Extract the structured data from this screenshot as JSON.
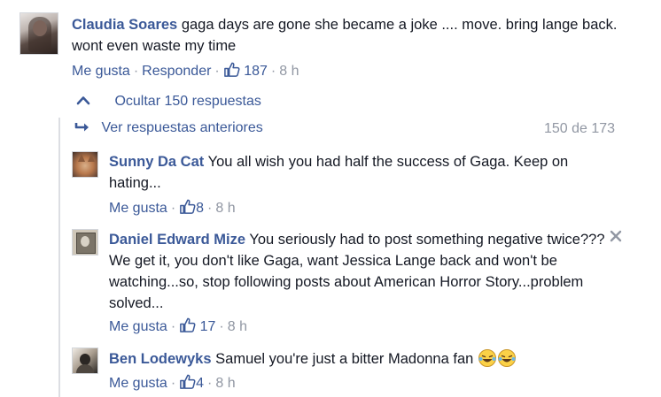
{
  "comment": {
    "author": "Claudia Soares",
    "text": "gaga days are gone she became a joke .... move. bring lange back. wont even waste my time",
    "like_label": "Me gusta",
    "reply_label": "Responder",
    "likes": "187",
    "time": "8 h"
  },
  "replies_controls": {
    "hide_label": "Ocultar 150 respuestas",
    "previous_label": "Ver respuestas anteriores",
    "count": "150 de 173"
  },
  "replies": [
    {
      "author": "Sunny Da Cat",
      "text": "You all wish you had half the success of Gaga. Keep on hating...",
      "like_label": "Me gusta",
      "likes": "8",
      "time": "8 h"
    },
    {
      "author": "Daniel Edward Mize",
      "text": "You seriously had to post something negative twice??? We get it, you don't like Gaga, want Jessica Lange back and won't be watching...so, stop following posts about American Horror Story...problem solved...",
      "like_label": "Me gusta",
      "likes": "17",
      "time": "8 h"
    },
    {
      "author": "Ben Lodewyks",
      "text": "Samuel you're just a bitter Madonna fan",
      "like_label": "Me gusta",
      "likes": "4",
      "time": "8 h"
    }
  ],
  "colors": {
    "link": "#3b5998",
    "grey": "#9197a3",
    "text": "#141823"
  },
  "icons": [
    "thumbs-up-icon",
    "chevron-up-icon",
    "reply-arrow-icon",
    "close-icon",
    "laughing-tears-emoji"
  ]
}
